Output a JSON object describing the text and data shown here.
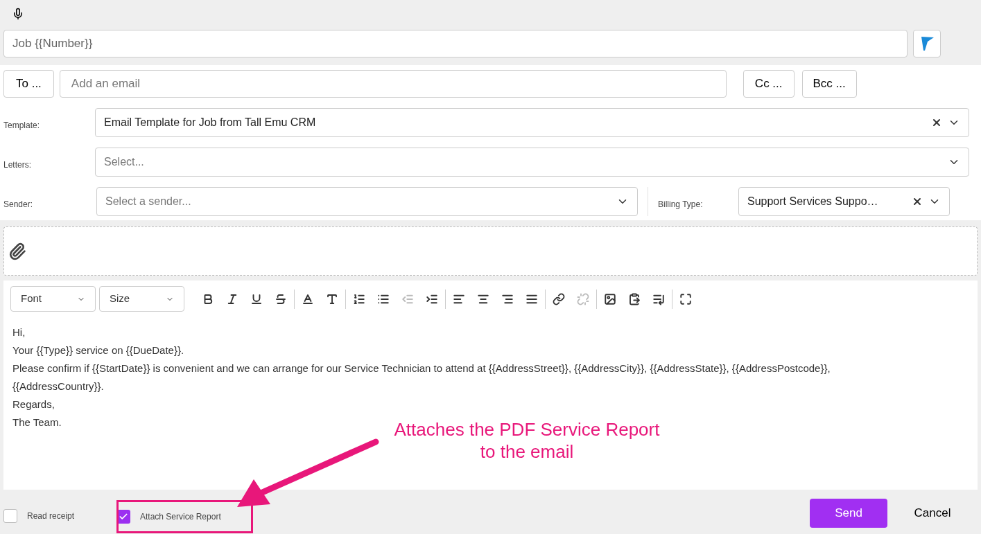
{
  "subject": {
    "value": "Job {{Number}}"
  },
  "recipients": {
    "to_button": "To ...",
    "email_placeholder": "Add an email",
    "cc_button": "Cc ...",
    "bcc_button": "Bcc ..."
  },
  "template": {
    "label": "Template:",
    "value": "Email Template for Job from Tall Emu CRM"
  },
  "letters": {
    "label": "Letters:",
    "placeholder": "Select..."
  },
  "sender": {
    "label": "Sender:",
    "placeholder": "Select a sender..."
  },
  "billing_type": {
    "label": "Billing Type:",
    "value": "Support Services Suppo…"
  },
  "toolbar": {
    "font": "Font",
    "size": "Size",
    "groups": [
      [
        {
          "kind": "bold",
          "disabled": false
        },
        {
          "kind": "italic",
          "disabled": false
        },
        {
          "kind": "underline",
          "disabled": false
        },
        {
          "kind": "strike",
          "disabled": false
        }
      ],
      [
        {
          "kind": "text-color",
          "disabled": false
        },
        {
          "kind": "bg-color",
          "disabled": false
        }
      ],
      [
        {
          "kind": "ordered-list",
          "disabled": false
        },
        {
          "kind": "bullet-list",
          "disabled": false
        },
        {
          "kind": "outdent",
          "disabled": true
        },
        {
          "kind": "indent",
          "disabled": false
        }
      ],
      [
        {
          "kind": "align-left",
          "disabled": false
        },
        {
          "kind": "align-center",
          "disabled": false
        },
        {
          "kind": "align-right",
          "disabled": false
        },
        {
          "kind": "justify",
          "disabled": false
        }
      ],
      [
        {
          "kind": "link",
          "disabled": false
        },
        {
          "kind": "unlink",
          "disabled": true
        }
      ],
      [
        {
          "kind": "image",
          "disabled": false
        },
        {
          "kind": "paste",
          "disabled": false
        },
        {
          "kind": "page-break",
          "disabled": false
        }
      ],
      [
        {
          "kind": "maximize",
          "disabled": false
        }
      ]
    ]
  },
  "body": [
    "Hi,",
    "Your {{Type}} service on {{DueDate}}.",
    "Please confirm if {{StartDate}} is convenient and we can arrange for our Service Technician to attend at {{AddressStreet}}, {{AddressCity}}, {{AddressState}}, {{AddressPostcode}},",
    "{{AddressCountry}}.",
    "Regards,",
    "The Team."
  ],
  "options": [
    {
      "label": "Read receipt",
      "checked": false
    },
    {
      "label": "Attach Service Report",
      "checked": true
    }
  ],
  "send_button": "Send",
  "cancel_button": "Cancel",
  "annotation": {
    "text": "Attaches the PDF Service Report to the email"
  }
}
